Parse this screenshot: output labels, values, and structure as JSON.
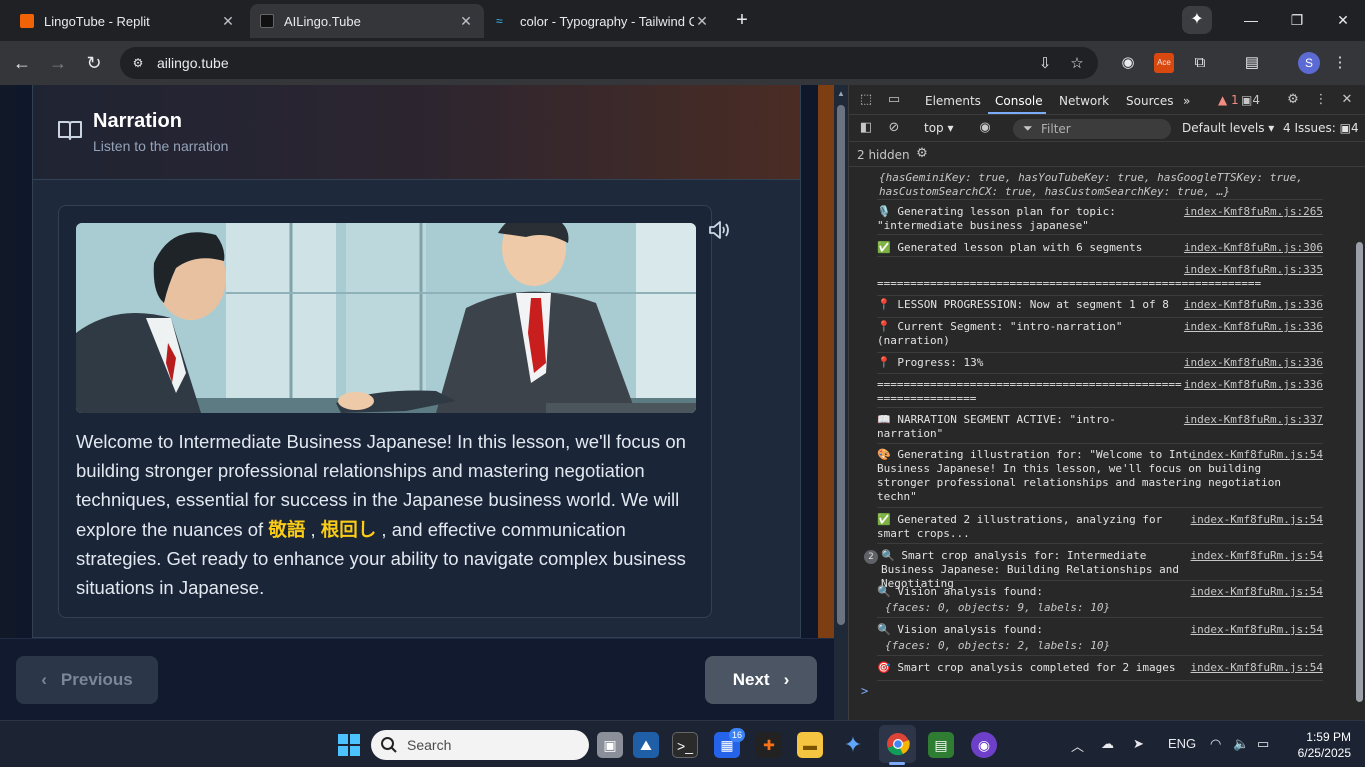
{
  "browser": {
    "tabs": [
      {
        "title": "LingoTube - Replit",
        "favicon_color": "#f26207"
      },
      {
        "title": "AILingo.Tube",
        "favicon_color": "#111111"
      },
      {
        "title": "color - Typography - Tailwind CSS",
        "favicon_color": "#38bdf8"
      }
    ],
    "active_tab_index": 1,
    "new_tab_label": "+",
    "url": "ailingo.tube",
    "profile_initial": "S"
  },
  "page": {
    "header_title": "Narration",
    "header_subtitle": "Listen to the narration",
    "narration_before": "Welcome to Intermediate Business Japanese! In this lesson, we'll focus on building stronger professional relationships and mastering negotiation techniques, essential for success in the Japanese business world. We will explore the nuances of ",
    "highlight_1": "敬語",
    "separator": " , ",
    "highlight_2": "根回し",
    "narration_after": " , and effective communication strategies. Get ready to enhance your ability to navigate complex business situations in Japanese.",
    "prev_label": "Previous",
    "next_label": "Next"
  },
  "devtools": {
    "tabs": [
      "Elements",
      "Console",
      "Network",
      "Sources"
    ],
    "active_tab": "Console",
    "more_tabs": "»",
    "warning_count": "1",
    "message_count": "4",
    "context": "top ▾",
    "filter_placeholder": "Filter",
    "levels": "Default levels ▾",
    "issues": "4 Issues: ",
    "issues_count": "4",
    "hidden": "2 hidden",
    "logs": [
      {
        "text": "{hasGeminiKey: true, hasYouTubeKey: true, hasGoogleTTSKey: true, hasCustomSearchCX: true, hasCustomSearchKey: true, …}",
        "link": ""
      },
      {
        "text": "🎙️ Generating lesson plan for topic: \"intermediate business japanese\"",
        "link": "index-Kmf8fuRm.js:265"
      },
      {
        "text": "✅ Generated lesson plan with 6 segments",
        "link": "index-Kmf8fuRm.js:306"
      },
      {
        "text": "",
        "link": "index-Kmf8fuRm.js:335"
      },
      {
        "text": "==========================================================",
        "link": ""
      },
      {
        "text": "📍 LESSON PROGRESSION: Now at segment 1 of 8",
        "link": "index-Kmf8fuRm.js:336"
      },
      {
        "text": "📍 Current Segment: \"intro-narration\" (narration)",
        "link": "index-Kmf8fuRm.js:336"
      },
      {
        "text": "📍 Progress: 13%",
        "link": "index-Kmf8fuRm.js:336"
      },
      {
        "text": "============================================== ===============",
        "link": "index-Kmf8fuRm.js:336"
      },
      {
        "text": "📖 NARRATION SEGMENT ACTIVE: \"intro-narration\"",
        "link": "index-Kmf8fuRm.js:337"
      },
      {
        "text": "🎨 Generating illustration for: \"Welcome to Intermediate Business Japanese! In this lesson, we'll focus on building stronger professional relationships and mastering negotiation techn\"",
        "link": "index-Kmf8fuRm.js:54"
      },
      {
        "text": "✅ Generated 2 illustrations, analyzing for smart crops...",
        "link": "index-Kmf8fuRm.js:54"
      },
      {
        "text": "🔍 Smart crop analysis for: Intermediate Business Japanese: Building Relationships and Negotiating",
        "link": "index-Kmf8fuRm.js:54",
        "count": "2"
      },
      {
        "text": "🔍 Vision analysis found:",
        "link": "index-Kmf8fuRm.js:54",
        "object": "{faces: 0, objects: 9, labels: 10}"
      },
      {
        "text": "🔍 Vision analysis found:",
        "link": "index-Kmf8fuRm.js:54",
        "object": "{faces: 0, objects: 2, labels: 10}"
      },
      {
        "text": "🎯 Smart crop analysis completed for 2 images",
        "link": "index-Kmf8fuRm.js:54"
      }
    ],
    "prompt": ">"
  },
  "taskbar": {
    "search_placeholder": "Search",
    "teams_badge": "16",
    "language": "ENG",
    "time": "1:59 PM",
    "date": "6/25/2025"
  }
}
